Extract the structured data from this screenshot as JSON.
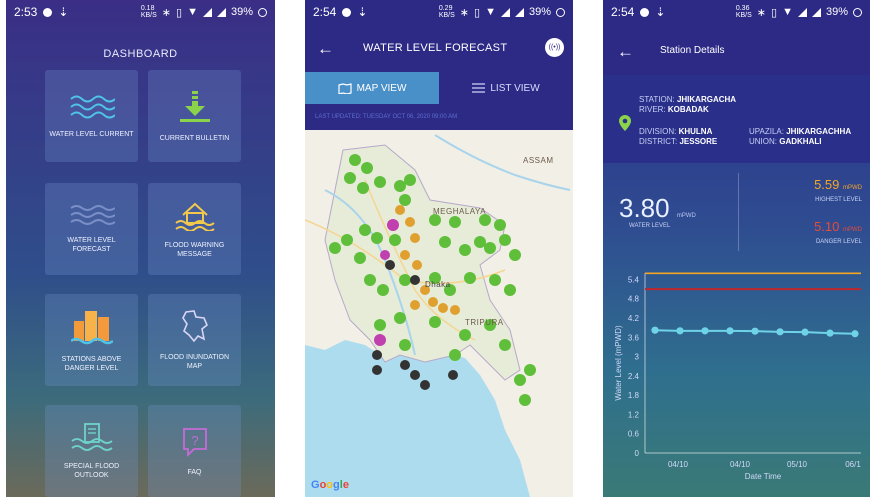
{
  "status": {
    "p1_time": "2:53",
    "p2_time": "2:54",
    "p3_time": "2:54",
    "p1_speed": "0.18\nKB/S",
    "p2_speed": "0.29\nKB/S",
    "p3_speed": "0.36\nKB/S",
    "battery": "39%"
  },
  "dashboard": {
    "title": "DASHBOARD",
    "tiles": [
      {
        "label": "WATER LEVEL CURRENT",
        "icon": "waves-icon"
      },
      {
        "label": "CURRENT BULLETIN",
        "icon": "download-icon"
      },
      {
        "label": "WATER LEVEL FORECAST",
        "icon": "waves-icon"
      },
      {
        "label": "FLOOD WARNING MESSAGE",
        "icon": "flooded-house-icon"
      },
      {
        "label": "STATIONS ABOVE DANGER LEVEL",
        "icon": "buildings-icon"
      },
      {
        "label": "FLOOD INUNDATION MAP",
        "icon": "country-map-icon"
      },
      {
        "label": "SPECIAL FLOOD OUTLOOK",
        "icon": "document-waves-icon"
      },
      {
        "label": "FAQ",
        "icon": "question-icon"
      }
    ]
  },
  "forecast": {
    "title": "WATER LEVEL FORECAST",
    "tabs": {
      "map": "MAP VIEW",
      "list": "LIST VIEW"
    },
    "last_updated": "LAST UPDATED: TUESDAY OCT 06, 2020 09:00 AM",
    "map_labels": {
      "assam": "ASSAM",
      "meghalaya": "MEGHALAYA",
      "tripura": "TRIPURA",
      "dhaka": "Dhaka"
    },
    "google": "Google",
    "colors": {
      "green": "#5fbf3a",
      "orange": "#e0a030",
      "magenta": "#c040b0",
      "dark": "#333333"
    }
  },
  "station": {
    "title": "Station Details",
    "station_label": "STATION:",
    "station": "JHIKARGACHA",
    "river_label": "RIVER:",
    "river": "KOBADAK",
    "division_label": "DIVISION:",
    "division": "KHULNA",
    "district_label": "DISTRICT:",
    "district": "JESSORE",
    "upazila_label": "UPAZILA:",
    "upazila": "JHIKARGACHHA",
    "union_label": "UNION:",
    "union": "GADKHALI",
    "water_level": "3.80",
    "water_unit": "mPWD",
    "water_label": "WATER LEVEL",
    "highest": "5.59",
    "highest_unit": "mPWD",
    "highest_label": "HIGHEST LEVEL",
    "danger": "5.10",
    "danger_unit": "mPWD",
    "danger_label": "DANGER LEVEL"
  },
  "chart_data": {
    "type": "line",
    "ylabel": "Water Level (mPWD)",
    "xlabel": "Date Time",
    "y_ticks": [
      "5.4",
      "4.8",
      "4.2",
      "3.6",
      "3",
      "2.4",
      "1.8",
      "1.2",
      "0.6",
      "0"
    ],
    "ylim": [
      0,
      5.6
    ],
    "x_ticks": [
      "04/10",
      "04/10",
      "05/10",
      "06/1"
    ],
    "series": [
      {
        "values": [
          3.82,
          3.8,
          3.8,
          3.8,
          3.79,
          3.77,
          3.76,
          3.73,
          3.71
        ],
        "color": "#6fd3e8"
      }
    ],
    "highest_level": 5.59,
    "danger_level": 5.1,
    "highest_color": "#f5a623",
    "danger_color": "#c0262a",
    "grid": false
  }
}
